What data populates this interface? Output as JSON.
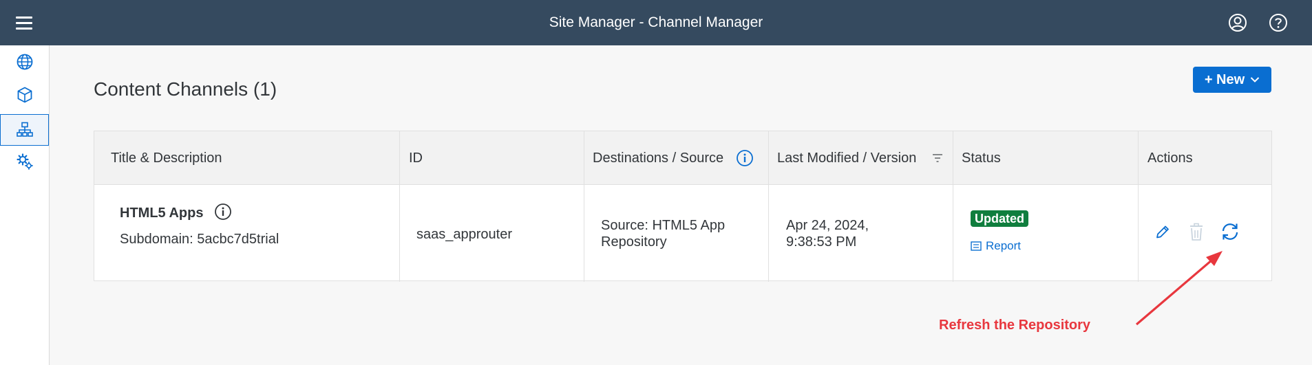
{
  "shell": {
    "title": "Site Manager - Channel Manager",
    "menu_icon": "hamburger-icon",
    "profile_icon": "user-circle-icon",
    "help_icon": "question-circle-icon"
  },
  "sidenav": {
    "items": [
      {
        "icon": "globe-icon",
        "active": false
      },
      {
        "icon": "cube-icon",
        "active": false
      },
      {
        "icon": "hierarchy-icon",
        "active": true
      },
      {
        "icon": "settings-gears-icon",
        "active": false
      }
    ]
  },
  "page": {
    "title": "Content Channels (1)",
    "new_button": "+ New"
  },
  "table": {
    "headers": {
      "title": "Title & Description",
      "id": "ID",
      "destinations": "Destinations / Source",
      "modified": "Last Modified / Version",
      "status": "Status",
      "actions": "Actions"
    },
    "rows": [
      {
        "title": "HTML5 Apps",
        "description": "Subdomain: 5acbc7d5trial",
        "id": "saas_approuter",
        "source_line1": "Source: HTML5 App",
        "source_line2": "Repository",
        "date": "Apr 24, 2024,",
        "time": "9:38:53 PM",
        "status": "Updated",
        "report": "Report"
      }
    ]
  },
  "annotation": {
    "text": "Refresh the Repository",
    "color": "#e8373e"
  },
  "colors": {
    "shellbar": "#354a5f",
    "accent": "#0a6ed1",
    "success": "#107e3e"
  }
}
